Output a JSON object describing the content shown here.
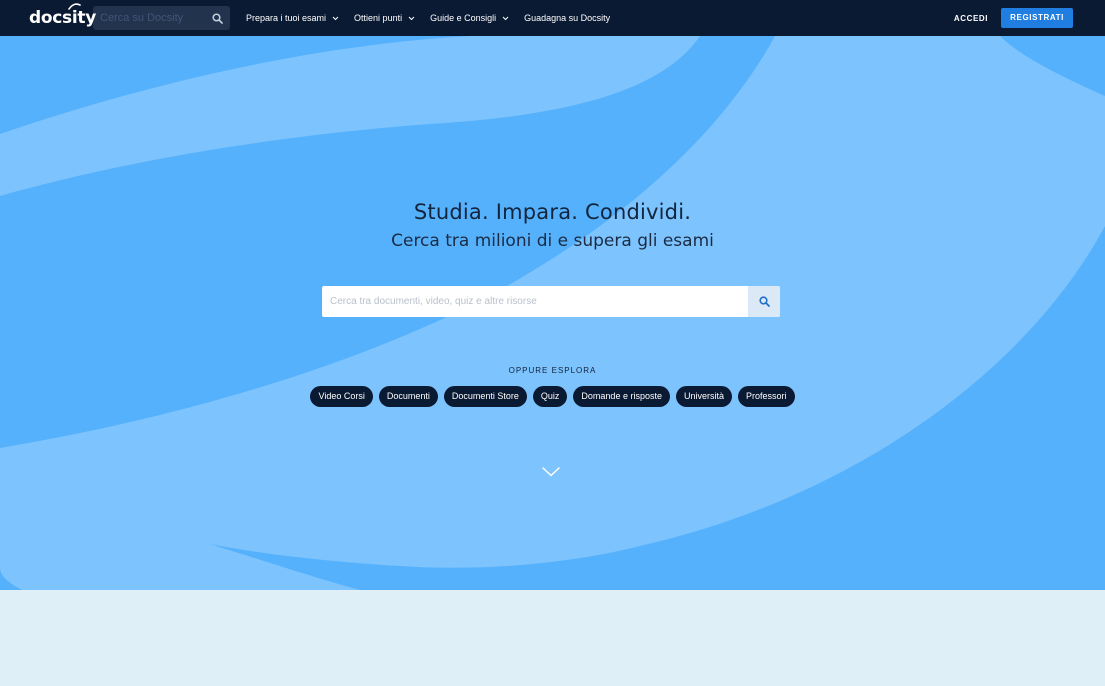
{
  "navbar": {
    "logo": "docsity",
    "search": {
      "placeholder": "Cerca su Docsity",
      "icon": "search-icon"
    },
    "menu": [
      {
        "label": "Prepara i tuoi esami",
        "dropdown": true
      },
      {
        "label": "Ottieni punti",
        "dropdown": true
      },
      {
        "label": "Guide e Consigli",
        "dropdown": true
      },
      {
        "label": "Guadagna su Docsity",
        "dropdown": false
      }
    ],
    "login_label": "ACCEDI",
    "register_label": "REGISTRATI"
  },
  "hero": {
    "title": "Studia. Impara. Condividi.",
    "subtitle": "Cerca tra milioni di e supera gli esami",
    "search": {
      "placeholder": "Cerca tra documenti, video, quiz e altre risorse",
      "icon": "search-icon"
    },
    "explore_label": "OPPURE ESPLORA",
    "chips": [
      "Video Corsi",
      "Documenti",
      "Documenti Store",
      "Quiz",
      "Domande e risposte",
      "Università",
      "Professori"
    ],
    "scroll_icon": "chevron-down-icon"
  },
  "colors": {
    "navbar_bg": "#0b1a33",
    "hero_bg": "#7dc3fd",
    "hero_band": "#55b1fc",
    "accent": "#1f7ee0",
    "bottom_bg": "#dfeff8"
  }
}
